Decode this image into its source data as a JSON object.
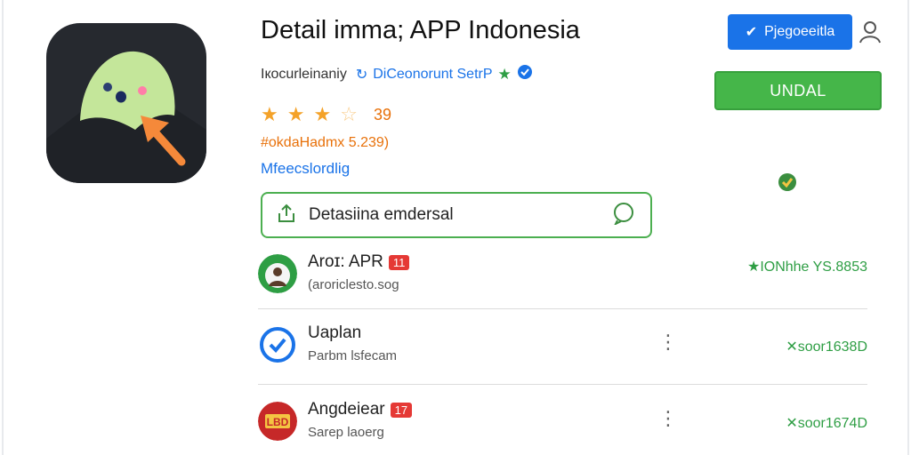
{
  "app": {
    "title": "Detail imma; APP Indonesia",
    "developer_name": "Iкoсurleinaniy",
    "developer_link": "DiCeonorunt SetrP",
    "rating_value": "39",
    "stars_filled": 3,
    "reviews_text": "#okdaHadmx  5.239)",
    "category": "Mfeecslordlig",
    "share_label": "Detasiina emdersal"
  },
  "header": {
    "register_label": "Pjegoeeitla",
    "install_label": "UNDAL"
  },
  "list": [
    {
      "name": "Aroɪ: APR",
      "badge": "11",
      "sub": "(aroriclesto.sog",
      "right": "★IONhhe YS.8853"
    },
    {
      "name": "Uaplan",
      "badge": "",
      "sub": "Parbm lsfecam",
      "right": "✕soor1638D"
    },
    {
      "name": "Angdeiear",
      "badge": "17",
      "sub": "Sarep laoerg",
      "right": "✕soor1674D"
    }
  ],
  "colors": {
    "accent_blue": "#1a73e8",
    "install_green": "#45b649",
    "star_orange": "#f4a229",
    "icon_bg": "#26292f",
    "icon_blob": "#c4e69a"
  },
  "icons": [
    "app-logo-icon",
    "verified-icon",
    "star-icon",
    "share-icon",
    "chat-icon",
    "check-icon",
    "user-icon",
    "more-vert-icon"
  ]
}
